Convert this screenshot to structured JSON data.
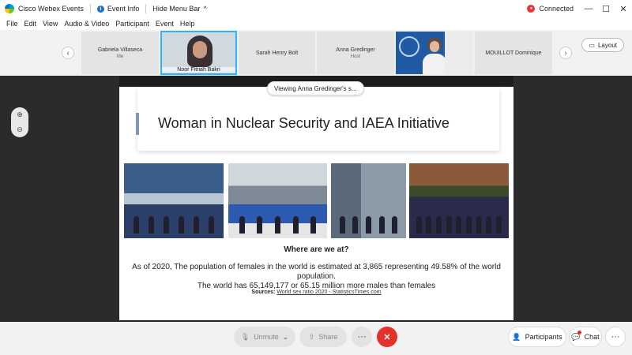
{
  "titlebar": {
    "app_name": "Cisco Webex Events",
    "event_info": "Event Info",
    "hide_menu": "Hide Menu Bar",
    "hide_menu_chevron": "^",
    "connected": "Connected",
    "minimize": "—",
    "maximize": "☐",
    "close": "✕"
  },
  "menu": [
    "File",
    "Edit",
    "View",
    "Audio & Video",
    "Participant",
    "Event",
    "Help"
  ],
  "participants": [
    {
      "name": "Gabriela Villaseca",
      "sub": "Me"
    },
    {
      "name": "Noor Fitriah Bakri",
      "sub": ""
    },
    {
      "name": "Sarah Henry Bolt",
      "sub": ""
    },
    {
      "name": "Anna Gredinger",
      "sub": "Host"
    },
    {
      "name": "",
      "sub": ""
    },
    {
      "name": "MOUILLOT Dominique",
      "sub": ""
    }
  ],
  "layout_label": "Layout",
  "viewing_label": "Viewing Anna Gredinger's s...",
  "slide": {
    "title": "Woman in Nuclear Security and IAEA Initiative",
    "heading": "Where are we at?",
    "para_line1": "As of 2020, The population of females in the world is estimated at 3,865 representing 49.58% of the world",
    "para_line2": "population.",
    "para_line3": "The world has 65,149,177 or 65.15 million more males than females",
    "sources_label": "Sources:",
    "sources_link": "World sex ratio 2020 - StatisticsTimes.com"
  },
  "controls": {
    "unmute": "Unmute",
    "share": "Share",
    "more": "···",
    "leave": "✕",
    "participants": "Participants",
    "chat": "Chat",
    "more_right": "···"
  },
  "colors": {
    "accent": "#2db3ff",
    "leave": "#e4322b",
    "stage": "#2b2b2b"
  }
}
